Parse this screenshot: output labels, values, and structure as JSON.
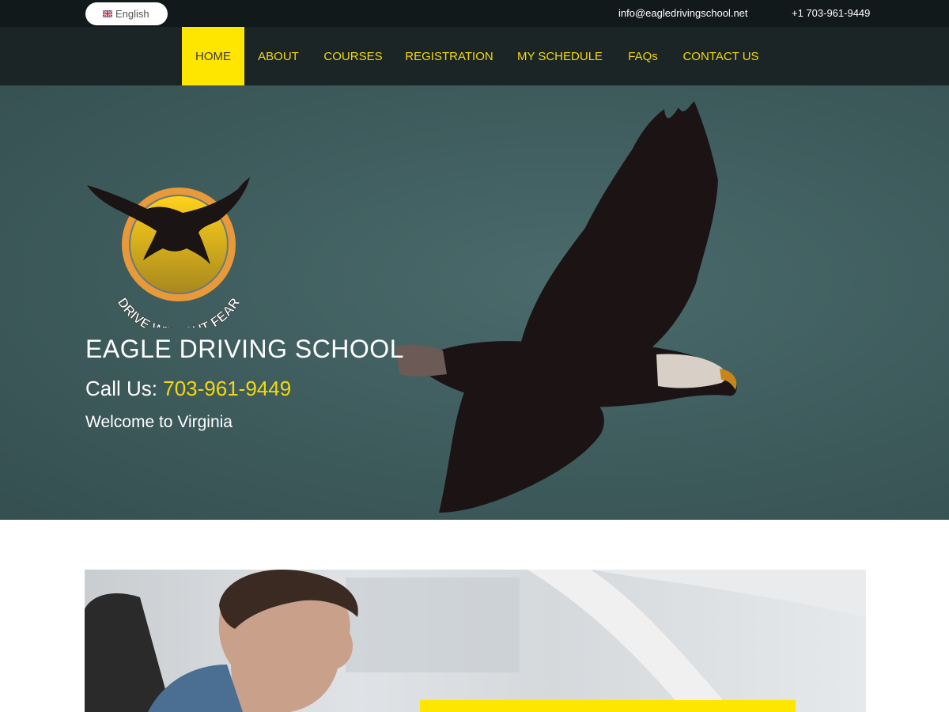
{
  "topbar": {
    "language": "English",
    "email": "info@eagledrivingschool.net",
    "phone": "+1 703-961-9449"
  },
  "nav": {
    "items": [
      {
        "label": "HOME",
        "active": true
      },
      {
        "label": "ABOUT"
      },
      {
        "label": "COURSES"
      },
      {
        "label": "REGISTRATION"
      },
      {
        "label": "MY SCHEDULE"
      },
      {
        "label": "FAQs"
      },
      {
        "label": "CONTACT US"
      }
    ]
  },
  "hero": {
    "logo_text": "DRIVE WITHOUT FEAR",
    "title": "EAGLE DRIVING SCHOOL",
    "call_prefix": "Call Us: ",
    "call_number": "703-961-9449",
    "welcome": "Welcome to Virginia"
  },
  "colors": {
    "accent": "#ffe600",
    "link_yellow": "#f4d90e",
    "nav_bg": "#1c2526",
    "topbar_bg": "#12191a",
    "hero_bg": "#405e5f"
  }
}
